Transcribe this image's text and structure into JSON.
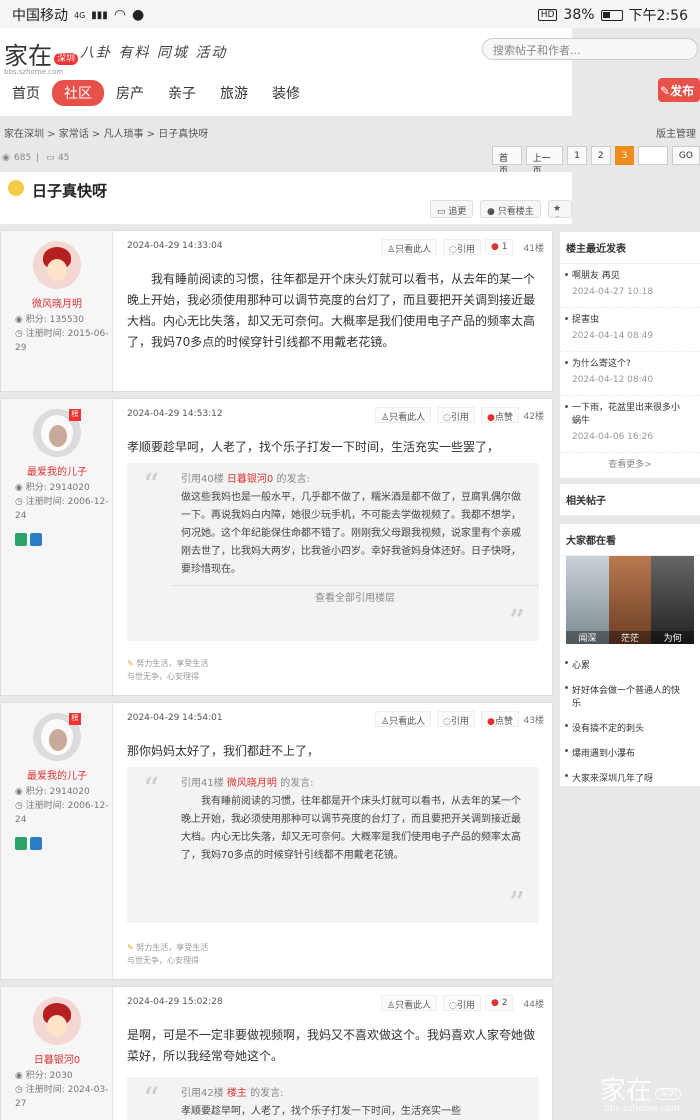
{
  "status": {
    "carrier": "中国移动",
    "net": "4G",
    "battery": "38%",
    "time": "下午2:56"
  },
  "header": {
    "logo": "家在",
    "logo_badge": "深圳",
    "logo_sub": "bbs.szhome.com",
    "slogan": "八卦 有料 同城 活动",
    "nav": [
      "首页",
      "社区",
      "房产",
      "亲子",
      "旅游",
      "装修"
    ],
    "search_placeholder": "搜索帖子和作者...",
    "publish": "发布"
  },
  "breadcrumb": [
    "家在深圳",
    "家常话",
    "凡人琐事",
    "日子真快呀"
  ],
  "admin": "版主管理",
  "stats": {
    "views": "685",
    "replies": "45"
  },
  "pager": {
    "home": "首页",
    "prev": "上一页",
    "pages": [
      "1",
      "2",
      "3"
    ],
    "current": "3",
    "go": "GO"
  },
  "thread": {
    "title": "日子真快呀",
    "btn_follow": "追更",
    "btn_only_owner": "只看楼主",
    "btn_fav": "收"
  },
  "posts": [
    {
      "user": "微风晓月明",
      "score_label": "积分:",
      "score": "135530",
      "reg_label": "注册时间:",
      "reg": "2015-06-29",
      "time": "2024-04-29 14:33:04",
      "only": "只看此人",
      "quote": "引用",
      "likes": "1",
      "floor": "41楼",
      "text": "我有睡前阅读的习惯，往年都是开个床头灯就可以看书，从去年的某一个晚上开始，我必须使用那种可以调节亮度的台灯了，而且要把开关调到接近最大档。内心无比失落，却又无可奈何。大概率是我们使用电子产品的频率太高了，我妈70多点的时候穿针引线都不用戴老花镜。"
    },
    {
      "user": "最爱我的儿子",
      "score_label": "积分:",
      "score": "2914020",
      "reg_label": "注册时间:",
      "reg": "2006-12-24",
      "time": "2024-04-29 14:53:12",
      "only": "只看此人",
      "quote": "引用",
      "likes": "点赞",
      "floor": "42楼",
      "text": "孝顺要趁早呵，人老了，找个乐子打发一下时间，生活充实一些罢了，",
      "q_head": "引用40楼 ",
      "q_name": "日暮银河0",
      "q_tail": " 的发言:",
      "q_text": "做这些我妈也是一般水平，几乎都不做了，糯米酒是都不做了，豆腐乳偶尔做一下。再说我妈白内障，她很少玩手机，不可能去学做视频了。我都不想学，何况她。这个年纪能保住命都不错了。刚刚我父母跟我视频，说家里有个亲戚刚去世了，比我妈大两岁，比我爸小四岁。幸好我爸妈身体还好。日子快呀，要珍惜现在。",
      "q_all": "查看全部引用楼层",
      "sig1": "努力生活，享受生活",
      "sig2": "与世无争，心安理得"
    },
    {
      "user": "最爱我的儿子",
      "score_label": "积分:",
      "score": "2914020",
      "reg_label": "注册时间:",
      "reg": "2006-12-24",
      "time": "2024-04-29 14:54:01",
      "only": "只看此人",
      "quote": "引用",
      "likes": "点赞",
      "floor": "43楼",
      "text": "那你妈妈太好了，我们都赶不上了，",
      "q_head": "引用41楼 ",
      "q_name": "微风晓月明",
      "q_tail": " 的发言:",
      "q_text": "我有睡前阅读的习惯，往年都是开个床头灯就可以看书，从去年的某一个晚上开始，我必须使用那种可以调节亮度的台灯了，而且要把开关调到接近最大档。内心无比失落，却又无可奈何。大概率是我们使用电子产品的频率太高了，我妈70多点的时候穿针引线都不用戴老花镜。",
      "sig1": "努力生活，享受生活",
      "sig2": "与世无争，心安理得"
    },
    {
      "user": "日暮银河0",
      "score_label": "积分:",
      "score": "2030",
      "reg_label": "注册时间:",
      "reg": "2024-03-27",
      "time": "2024-04-29 15:02:28",
      "only": "只看此人",
      "quote": "引用",
      "likes": "2",
      "floor": "44楼",
      "text": "是啊，可是不一定非要做视频啊，我妈又不喜欢做这个。我妈喜欢人家夸她做菜好，所以我经常夸她这个。",
      "q_head": "引用42楼 ",
      "q_name": "楼主",
      "q_tail": " 的发言:",
      "q_text": "孝顺要趁早呵，人老了，找个乐子打发一下时间，生活充实一些"
    }
  ],
  "sidebar": {
    "recent_title": "楼主最近发表",
    "recent": [
      {
        "title": "啊朋友 再见",
        "date": "2024-04-27 10:18"
      },
      {
        "title": "捉害虫",
        "date": "2024-04-14 08:49"
      },
      {
        "title": "为什么寄这个?",
        "date": "2024-04-12 08:40"
      },
      {
        "title": "一下雨，花盆里出来很多小蜗牛",
        "date": "2024-04-06 16:26"
      }
    ],
    "more": "查看更多>",
    "related_title": "相关帖子",
    "watching_title": "大家都在看",
    "photo_caps": [
      "闻深",
      "茫茫",
      "为何"
    ],
    "watching": [
      "心累",
      "好好体会做一个普通人的快乐",
      "没有搞不定的刺头",
      "爆雨遇到小瀑布",
      "大家来深圳几年了呀"
    ]
  },
  "watermark": {
    "text": "家在",
    "badge": "深圳",
    "sub": "bbs.szhome.com"
  }
}
